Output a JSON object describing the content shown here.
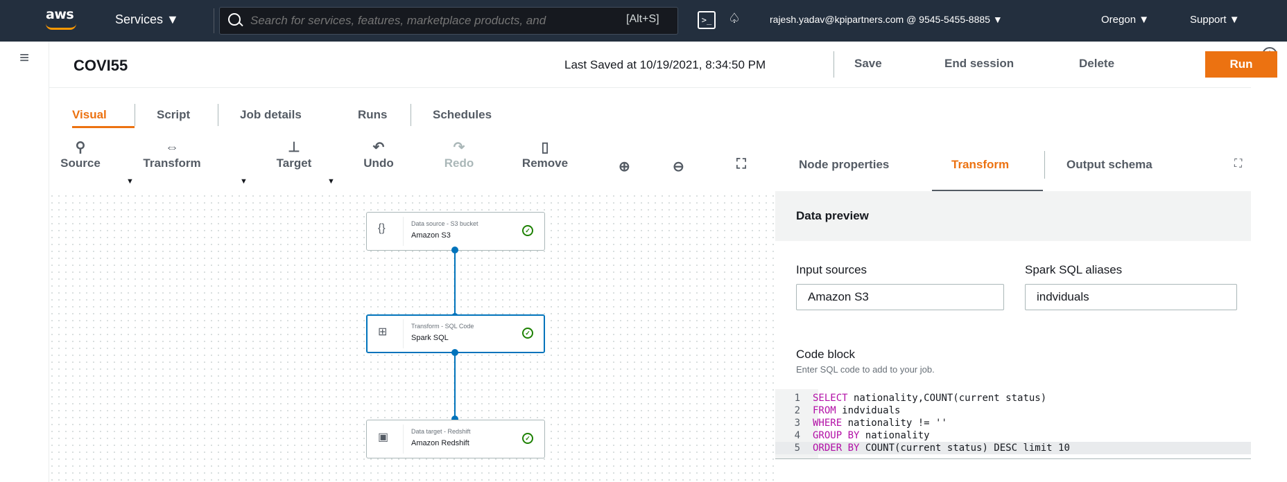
{
  "topbar": {
    "logo": "aws",
    "services": "Services ▼",
    "search_placeholder": "Search for services, features, marketplace products, and",
    "search_shortcut": "[Alt+S]",
    "cloudshell": ">_",
    "bell": "♤",
    "account": "rajesh.yadav@kpipartners.com @ 9545-5455-8885 ▼",
    "region": "Oregon ▼",
    "support": "Support ▼"
  },
  "header": {
    "job_title": "COVI55",
    "last_saved": "Last Saved at 10/19/2021, 8:34:50 PM",
    "save": "Save",
    "end_session": "End session",
    "delete": "Delete",
    "run": "Run"
  },
  "tabs": [
    "Visual",
    "Script",
    "Job details",
    "Runs",
    "Schedules"
  ],
  "toolbar": {
    "source": "Source",
    "transform": "Transform",
    "target": "Target",
    "undo": "Undo",
    "redo": "Redo",
    "remove": "Remove"
  },
  "nodes": [
    {
      "category": "Data source - S3 bucket",
      "name": "Amazon S3",
      "icon": "s3-bucket-icon"
    },
    {
      "category": "Transform - SQL Code",
      "name": "Spark SQL",
      "icon": "sql-transform-icon"
    },
    {
      "category": "Data target - Redshift",
      "name": "Amazon Redshift",
      "icon": "redshift-icon"
    }
  ],
  "panel": {
    "tabs": [
      "Node properties",
      "Transform",
      "Output schema"
    ],
    "data_preview": "Data preview",
    "input_sources_label": "Input sources",
    "input_sources_value": "Amazon S3",
    "aliases_label": "Spark SQL aliases",
    "aliases_value": "indviduals",
    "code_label": "Code block",
    "code_hint": "Enter SQL code to add to your job.",
    "code_lines": [
      {
        "n": "1",
        "kw": "SELECT",
        "rest": " nationality,COUNT(current status)"
      },
      {
        "n": "2",
        "kw": "FROM",
        "rest": " indviduals"
      },
      {
        "n": "3",
        "kw": "WHERE",
        "rest": " nationality != ''"
      },
      {
        "n": "4",
        "kw": "GROUP BY",
        "rest": " nationality"
      },
      {
        "n": "5",
        "kw": "ORDER BY",
        "rest": " COUNT(current status) DESC limit 10"
      }
    ]
  }
}
